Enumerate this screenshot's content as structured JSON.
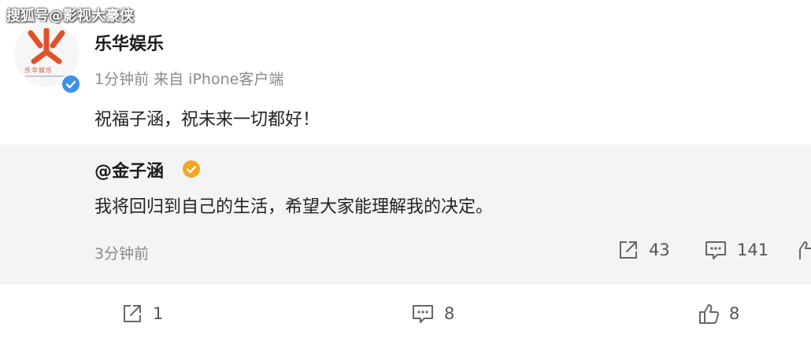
{
  "watermark": "搜狐号@影视大豪侠",
  "post": {
    "author": "乐华娱乐",
    "avatar_logo_text": "乐华娱乐",
    "meta": "1分钟前 来自 iPhone客户端",
    "text": "祝福子涵，祝未来一切都好！",
    "verified_icon": "verified-blue-icon",
    "actions": {
      "repost_count": "1",
      "comment_count": "8",
      "like_count": "8"
    }
  },
  "quoted": {
    "author": "@金子涵",
    "verified_icon": "verified-orange-icon",
    "text": "我将回归到自己的生活，希望大家能理解我的决定。",
    "time": "3分钟前",
    "actions": {
      "repost_count": "43",
      "comment_count": "141"
    }
  },
  "colors": {
    "quoted_background": "#f4f4f4",
    "verified_blue": "#3e90e8",
    "verified_orange": "#f5a623",
    "logo_orange": "#e2502a"
  }
}
